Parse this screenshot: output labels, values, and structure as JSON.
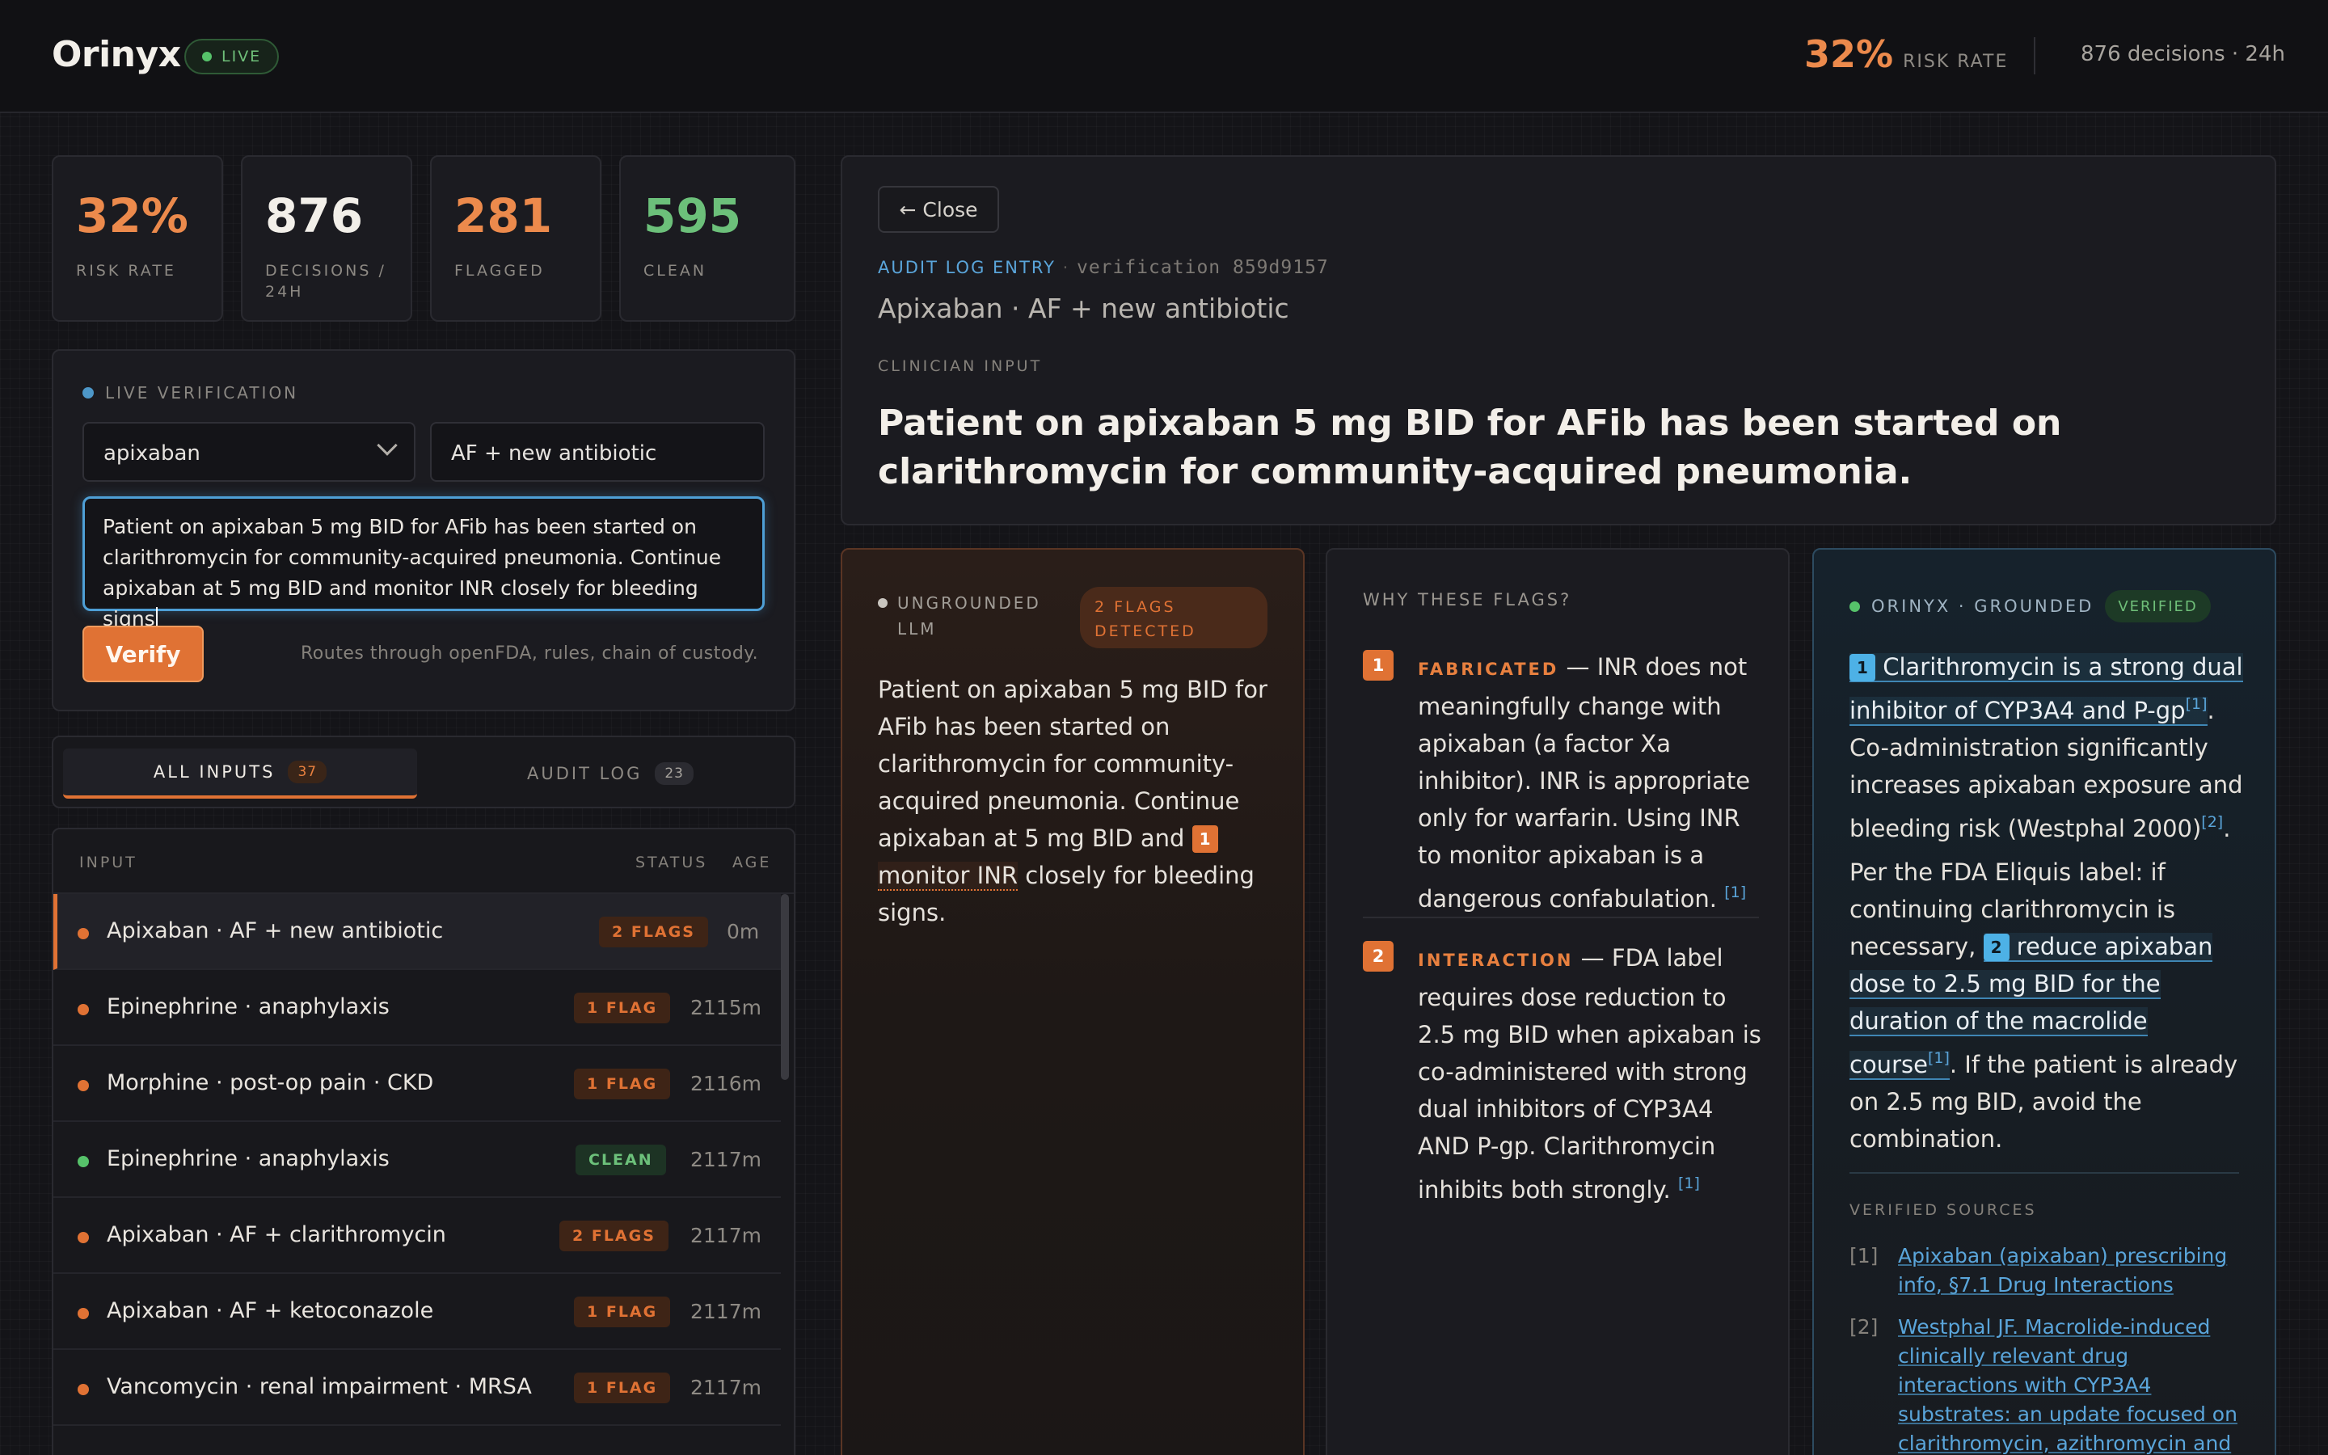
{
  "app": {
    "name": "Orinyx",
    "live_label": "LIVE"
  },
  "header": {
    "risk_value": "32%",
    "risk_label": "RISK RATE",
    "decisions": "876 decisions · 24h"
  },
  "stats": [
    {
      "value": "32%",
      "label": "RISK RATE",
      "color": "#ec8a4c"
    },
    {
      "value": "876",
      "label": "DECISIONS / 24H",
      "color": "#f2efe9"
    },
    {
      "value": "281",
      "label": "FLAGGED",
      "color": "#ec8a4c"
    },
    {
      "value": "595",
      "label": "CLEAN",
      "color": "#6cc07a"
    }
  ],
  "live_verification": {
    "title": "LIVE VERIFICATION",
    "drug": "apixaban",
    "context": "AF + new antibiotic",
    "input_text": "Patient on apixaban 5 mg BID for AFib has been started on clarithromycin for community-acquired pneumonia. Continue apixaban at 5 mg BID and monitor INR closely for bleeding signs",
    "verify_label": "Verify",
    "routes_note": "Routes through openFDA, rules, chain of custody."
  },
  "tabs": [
    {
      "label": "ALL INPUTS",
      "count": "37",
      "active": true
    },
    {
      "label": "AUDIT LOG",
      "count": "23",
      "active": false
    }
  ],
  "list": {
    "headers": {
      "input": "INPUT",
      "status": "STATUS",
      "age": "AGE"
    },
    "rows": [
      {
        "name": "Apixaban · AF + new antibiotic",
        "status": "2 FLAGS",
        "age": "0m",
        "kind": "flag"
      },
      {
        "name": "Epinephrine · anaphylaxis",
        "status": "1 FLAG",
        "age": "2115m",
        "kind": "flag"
      },
      {
        "name": "Morphine · post-op pain · CKD",
        "status": "1 FLAG",
        "age": "2116m",
        "kind": "flag"
      },
      {
        "name": "Epinephrine · anaphylaxis",
        "status": "CLEAN",
        "age": "2117m",
        "kind": "clean"
      },
      {
        "name": "Apixaban · AF + clarithromycin",
        "status": "2 FLAGS",
        "age": "2117m",
        "kind": "flag"
      },
      {
        "name": "Apixaban · AF + ketoconazole",
        "status": "1 FLAG",
        "age": "2117m",
        "kind": "flag"
      },
      {
        "name": "Vancomycin · renal impairment · MRSA",
        "status": "1 FLAG",
        "age": "2117m",
        "kind": "flag"
      }
    ]
  },
  "detail": {
    "close_label": "Close",
    "audit_label": "AUDIT LOG ENTRY",
    "verification_id": "verification 859d9157",
    "title": "Apixaban · AF + new antibiotic",
    "clinician_label": "CLINICIAN INPUT",
    "prompt": "Patient on apixaban 5 mg BID for AFib has been started on clarithromycin for community-acquired pneumonia."
  },
  "ungrounded": {
    "title": "UNGROUNDED LLM",
    "flags_badge": "2 FLAGS DETECTED",
    "text_before": "Patient on apixaban 5 mg BID for AFib has been started on clarithromycin for community-acquired pneumonia. Continue apixaban at 5 mg BID and ",
    "highlight_num": "1",
    "highlight": "monitor INR",
    "text_after": " closely for bleeding signs."
  },
  "why": {
    "title": "WHY THESE FLAGS?",
    "items": [
      {
        "num": "1",
        "kind": "FABRICATED",
        "text": " — INR does not meaningfully change with apixaban (a factor Xa inhibitor). INR is appropriate only for warfarin. Using INR to monitor apixaban is a dangerous confabulation.",
        "ref": "[1]"
      },
      {
        "num": "2",
        "kind": "INTERACTION",
        "text": " — FDA label requires dose reduction to 2.5 mg BID when apixaban is co-administered with strong dual inhibitors of CYP3A4 AND P-gp. Clarithromycin inhibits both strongly.",
        "ref": "[1]"
      }
    ]
  },
  "grounded": {
    "title": "ORINYX · GROUNDED",
    "verified_label": "VERIFIED",
    "p1_num": "1",
    "p1_highlight": "Clarithromycin is a strong dual inhibitor of CYP3A4 and P-gp",
    "p1_ref": "[1]",
    "p1_rest": ". Co-administration significantly increases apixaban exposure and bleeding risk (Westphal 2000)",
    "p1_ref2": "[2]",
    "p1_end": ".",
    "p2_before": "Per the FDA Eliquis label: if continuing clarithromycin is necessary, ",
    "p2_num": "2",
    "p2_highlight": "reduce apixaban dose to 2.5 mg BID for the duration of the macrolide course",
    "p2_ref": "[1]",
    "p2_after": ". If the patient is already on 2.5 mg BID, avoid the combination.",
    "sources_title": "VERIFIED SOURCES",
    "sources": [
      {
        "ref": "[1]",
        "text": "Apixaban (apixaban) prescribing info, §7.1 Drug Interactions"
      },
      {
        "ref": "[2]",
        "text": "Westphal JF. Macrolide-induced clinically relevant drug interactions with CYP3A4 substrates: an update focused on clarithromycin, azithromycin and dirithromycin. Br J"
      }
    ]
  }
}
